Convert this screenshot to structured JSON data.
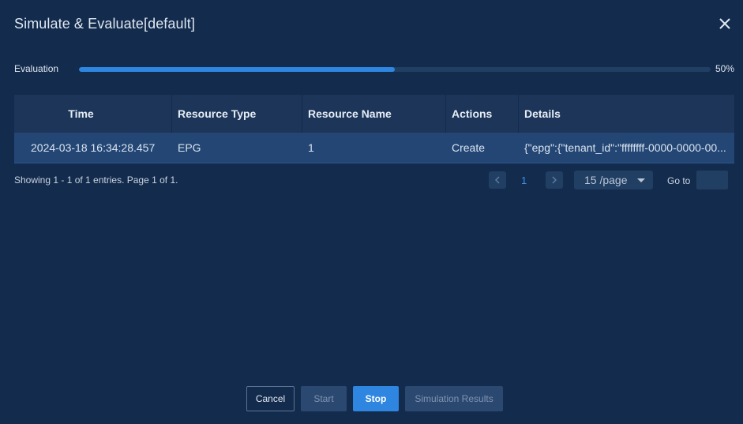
{
  "dialog": {
    "title": "Simulate & Evaluate[default]"
  },
  "progress": {
    "label": "Evaluation",
    "value": 0.5,
    "percent_text": "50%"
  },
  "table": {
    "columns": [
      "Time",
      "Resource Type",
      "Resource Name",
      "Actions",
      "Details"
    ],
    "rows": [
      [
        "2024-03-18 16:34:28.457",
        "EPG",
        "1",
        "Create",
        "{\"epg\":{\"tenant_id\":\"ffffffff-0000-0000-00..."
      ]
    ]
  },
  "pagination": {
    "info": "Showing 1 - 1 of 1 entries. Page 1 of 1.",
    "prev_icon": "chevron-left-icon",
    "current_page": "1",
    "next_icon": "chevron-right-icon",
    "page_size": "15 /page",
    "goto_label": "Go to",
    "goto_value": ""
  },
  "buttons": {
    "cancel": "Cancel",
    "start": "Start",
    "stop": "Stop",
    "results": "Simulation Results"
  },
  "colors": {
    "background": "#132b4c",
    "accent": "#2f86e0",
    "row_highlight": "#234674"
  }
}
